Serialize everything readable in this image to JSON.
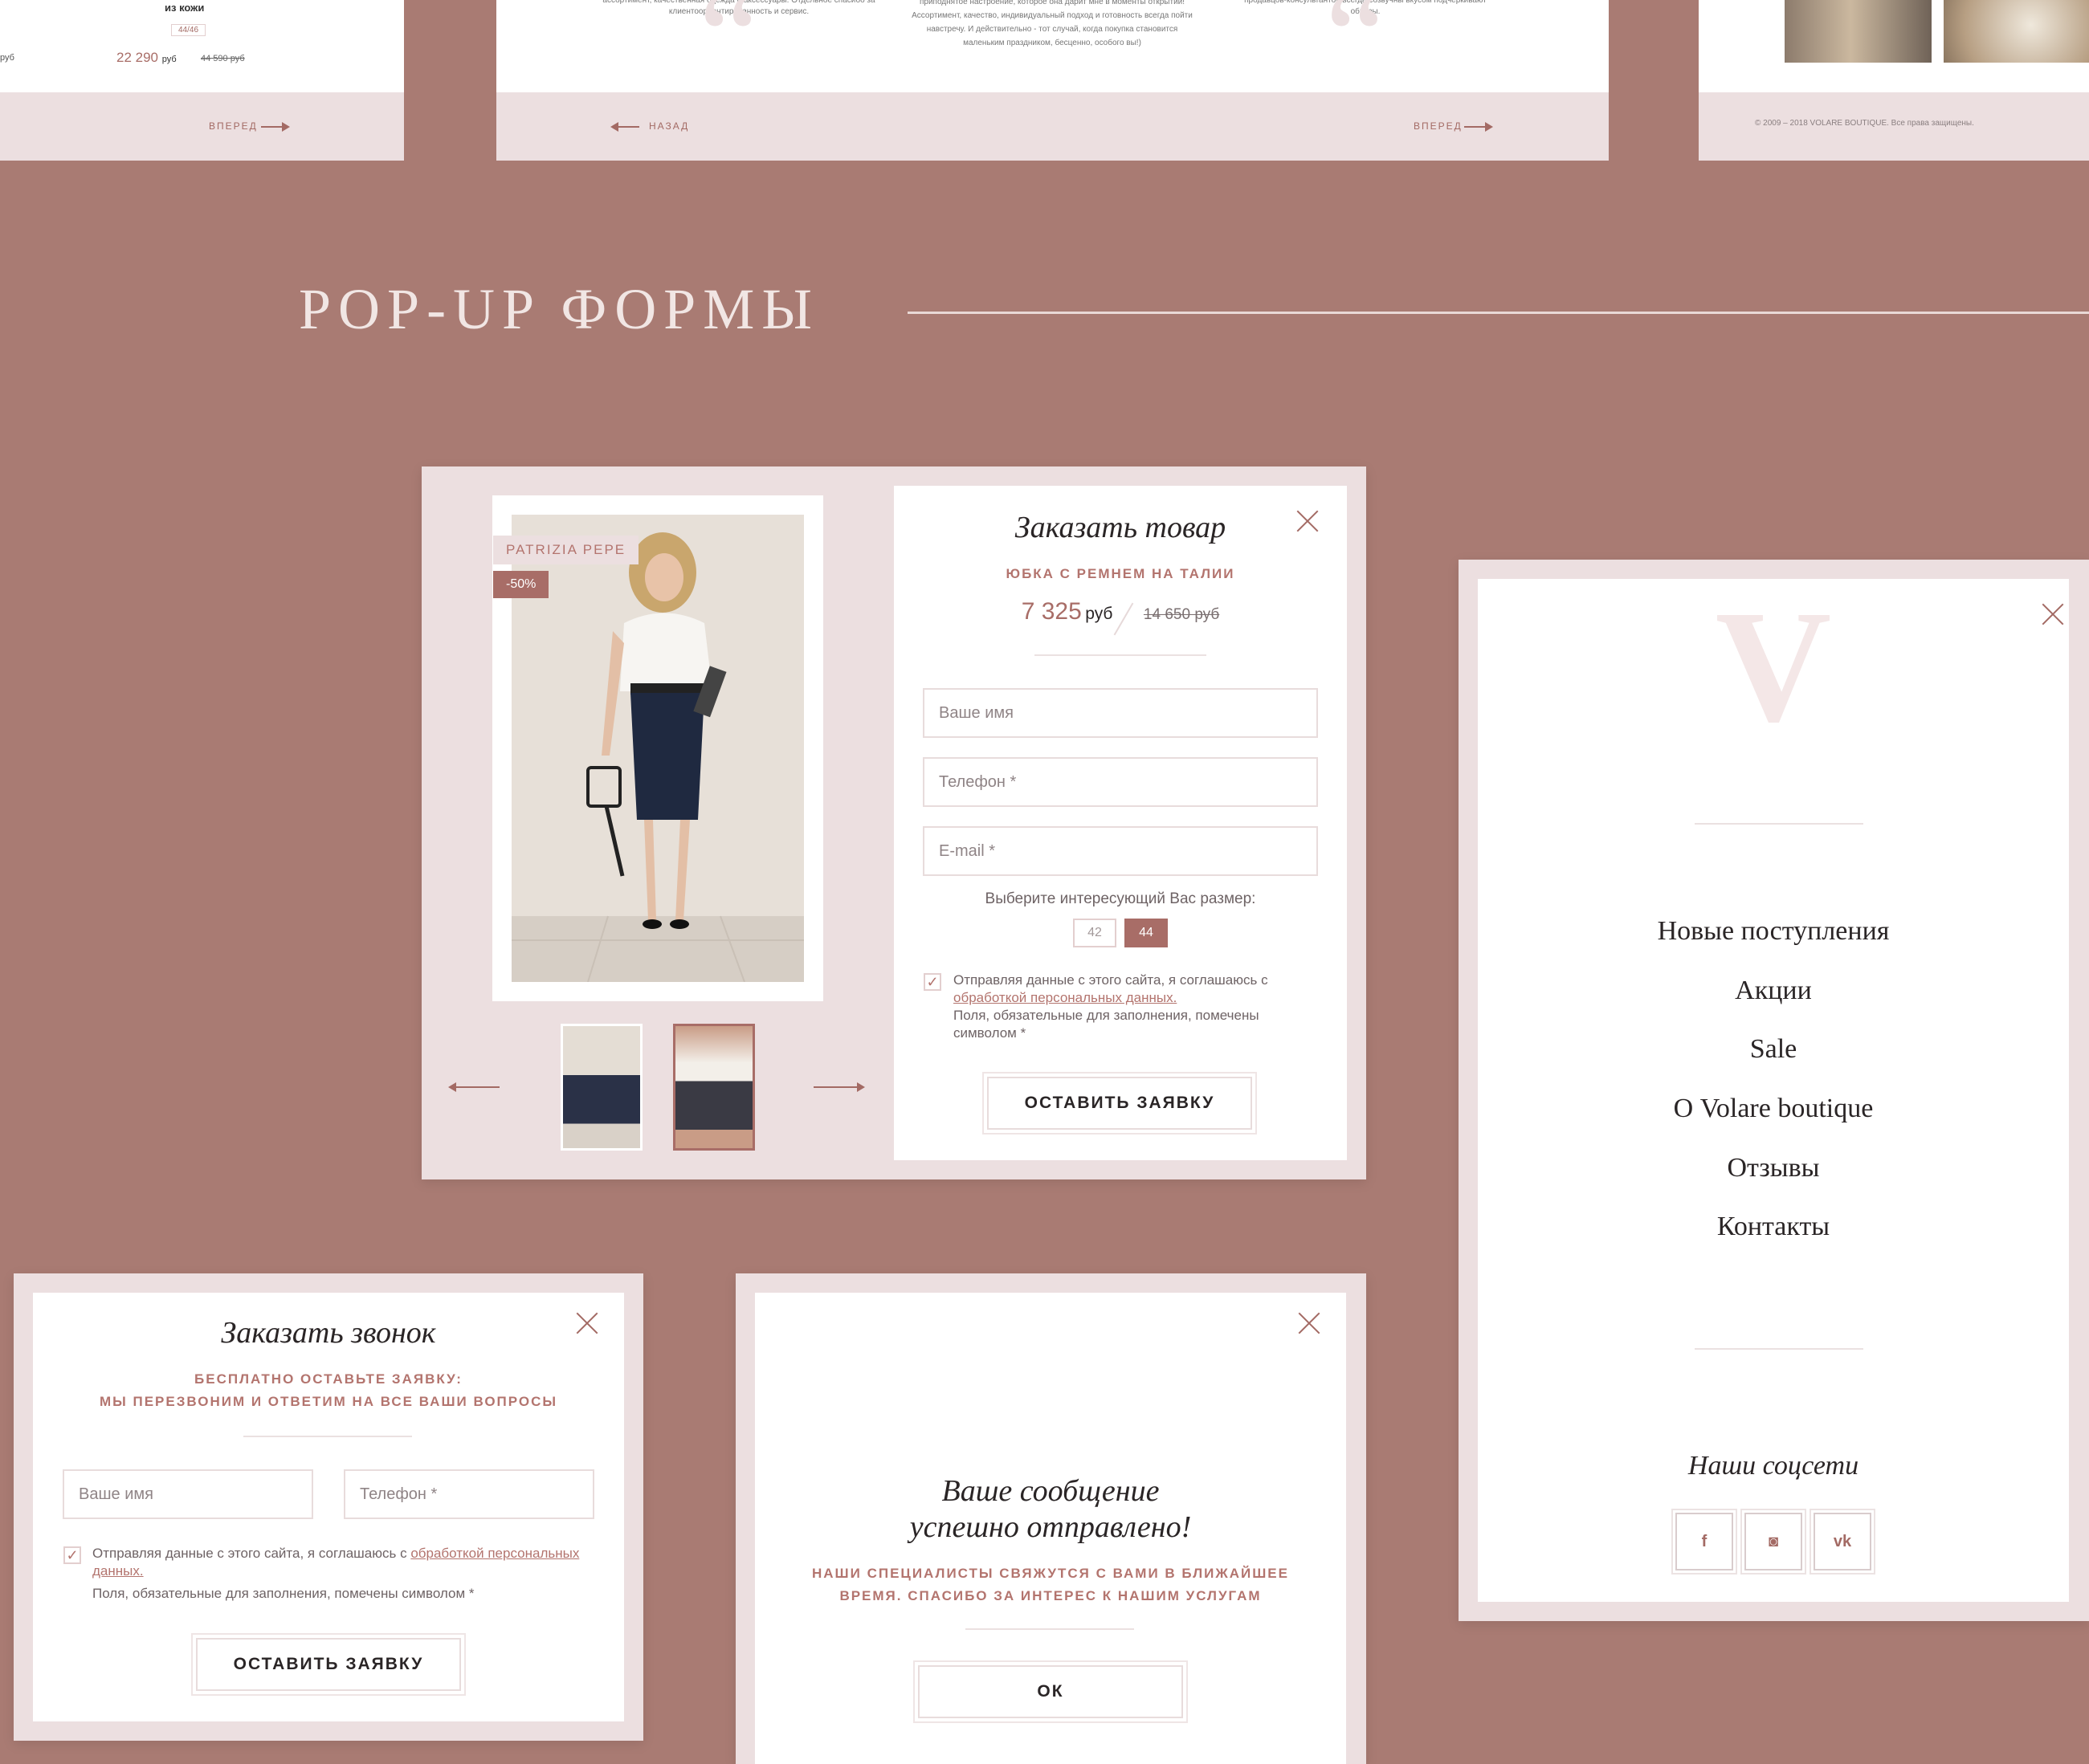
{
  "top_strip": {
    "left": {
      "name": "из кожи",
      "badge": "44/46",
      "price": "22 290",
      "currency": "руб",
      "old_price": "44 590 руб",
      "prev_price": "руб",
      "next_label": "ВПЕРЕД"
    },
    "middle": {
      "text_left": "ассортимент, качественная одежда и аксессуары. Отдельное спасибо за клиентоориентированность и сервис.",
      "text_center": "приподнятое настроение, которое она дарит мне в моменты открытий! Ассортимент, качество, индивидуальный подход и готовность всегда пойти навстречу. И действительно - тот случай, когда покупка становится маленьким праздником, бесценно, особого вы!)",
      "text_right": "продавцов-консультантов всегда созвучны вкусом подчеркивают образы.",
      "prev_label": "НАЗАД",
      "next_label": "ВПЕРЕД"
    },
    "right": {
      "copyright": "© 2009 – 2018 VOLARE BOUTIQUE. Все права защищены."
    }
  },
  "section": {
    "title": "POP-UP ФОРМЫ"
  },
  "order_product": {
    "brand": "PATRIZIA PEPE",
    "discount": "-50%",
    "title": "Заказать товар",
    "product_name": "ЮБКА С РЕМНЕМ НА ТАЛИИ",
    "price": "7 325",
    "currency": "руб",
    "old_price": "14 650 руб",
    "name_placeholder": "Ваше имя",
    "phone_placeholder": "Телефон *",
    "email_placeholder": "E-mail *",
    "size_label": "Выберите интересующий Вас размер:",
    "sizes": [
      "42",
      "44"
    ],
    "selected_size": "44",
    "consent_text": "Отправляя данные с этого сайта, я соглашаюсь с",
    "consent_link": "обработкой персональных данных.",
    "required_note": "Поля, обязательные для заполнения, помечены символом *",
    "submit_label": "ОСТАВИТЬ ЗАЯВКУ"
  },
  "callback": {
    "title": "Заказать звонок",
    "subtitle_line1": "БЕСПЛАТНО ОСТАВЬТЕ ЗАЯВКУ:",
    "subtitle_line2": "МЫ ПЕРЕЗВОНИМ И ОТВЕТИМ НА ВСЕ ВАШИ ВОПРОСЫ",
    "name_placeholder": "Ваше имя",
    "phone_placeholder": "Телефон *",
    "consent_text": "Отправляя данные с этого сайта, я соглашаюсь с",
    "consent_link": "обработкой персональных данных.",
    "required_note": "Поля, обязательные для заполнения, помечены символом *",
    "submit_label": "ОСТАВИТЬ ЗАЯВКУ"
  },
  "success": {
    "title_line1": "Ваше сообщение",
    "title_line2": "успешно отправлено!",
    "text_line1": "НАШИ СПЕЦИАЛИСТЫ СВЯЖУТСЯ С ВАМИ В БЛИЖАЙШЕЕ",
    "text_line2": "ВРЕМЯ. СПАСИБО ЗА ИНТЕРЕС К НАШИМ УСЛУГАМ",
    "ok_label": "ОК"
  },
  "mobile_menu": {
    "logo_letter": "V",
    "items": [
      "Новые поступления",
      "Акции",
      "Sale",
      "О Volare boutique",
      "Отзывы",
      "Контакты"
    ],
    "social_title": "Наши соцсети",
    "social": [
      {
        "icon": "facebook-icon",
        "glyph": "f"
      },
      {
        "icon": "instagram-icon",
        "glyph": "◙"
      },
      {
        "icon": "vk-icon",
        "glyph": "vk"
      }
    ]
  },
  "colors": {
    "background": "#a97b73",
    "panel": "#ecdfe0",
    "accent": "#a86d67",
    "text": "#2a2526"
  }
}
